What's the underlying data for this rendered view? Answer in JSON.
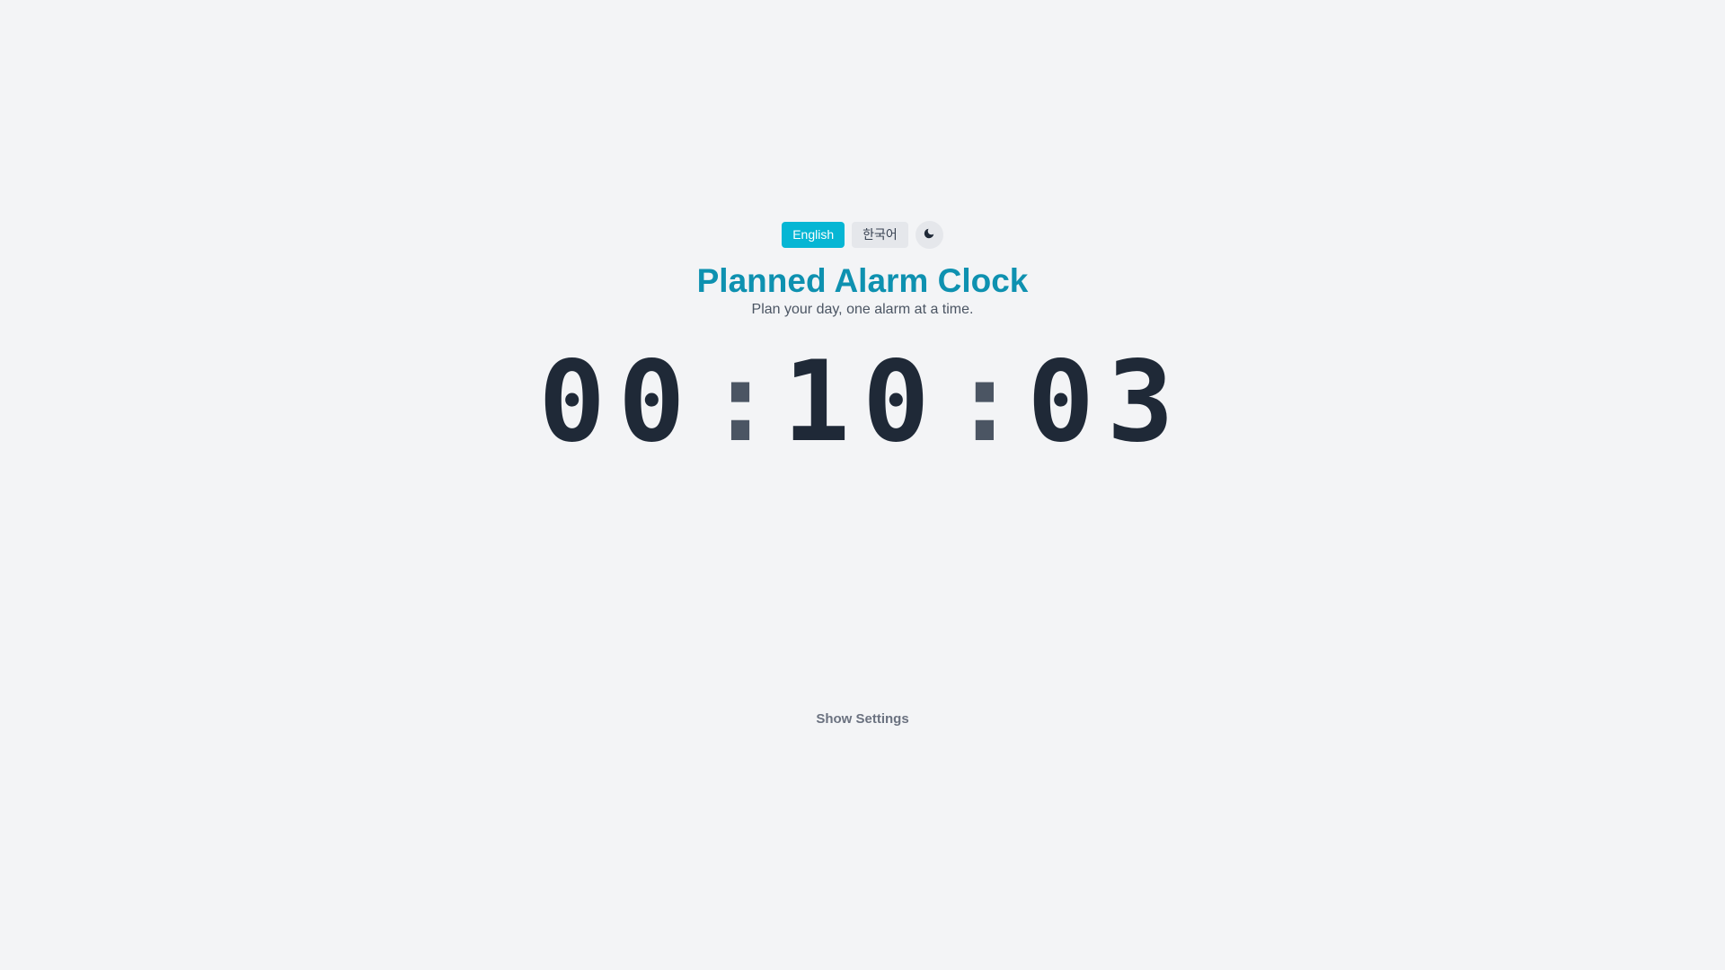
{
  "language_switcher": {
    "english_label": "English",
    "korean_label": "한국어",
    "active": "English"
  },
  "theme_toggle": {
    "icon": "moon-icon"
  },
  "header": {
    "title": "Planned Alarm Clock",
    "subtitle": "Plan your day, one alarm at a time."
  },
  "clock": {
    "hours": "00",
    "minutes": "10",
    "seconds": "03",
    "separator": ":"
  },
  "settings": {
    "toggle_label": "Show Settings"
  },
  "colors": {
    "background": "#f3f4f6",
    "accent": "#06b6d4",
    "title": "#0e91b0",
    "clock_digits": "#1f2937"
  }
}
